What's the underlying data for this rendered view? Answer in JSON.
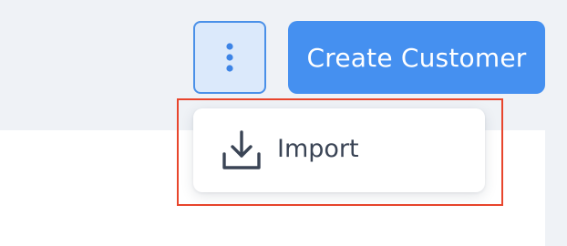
{
  "toolbar": {
    "more_icon": "vertical-ellipsis-icon",
    "create_label": "Create Customer"
  },
  "menu": {
    "items": [
      {
        "label": "Import",
        "icon": "download-icon"
      }
    ]
  },
  "colors": {
    "primary": "#4590f0",
    "more_button_bg": "#dbe9fb",
    "more_button_border": "#4a90e8",
    "highlight": "#e8452c",
    "page_bg": "#eff2f6",
    "text": "#3a4455"
  }
}
